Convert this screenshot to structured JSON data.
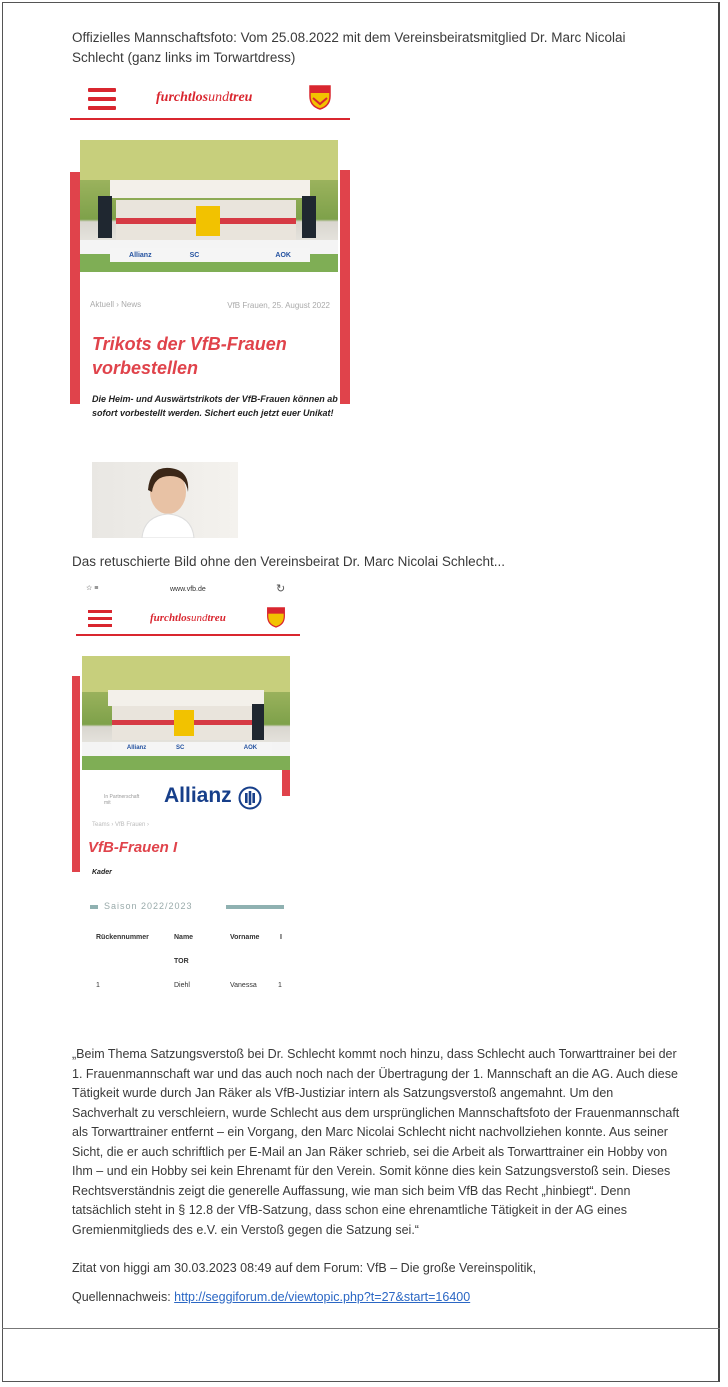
{
  "caption_top": "Offizielles Mannschaftsfoto: Vom 25.08.2022 mit dem Vereinsbeiratsmitglied Dr. Marc Nicolai Schlecht (ganz links im Torwartdress)",
  "brand": {
    "bold": "furchtlos",
    "thin": "und",
    "tail": "treu"
  },
  "sponsors": [
    "Allianz",
    "SC",
    "",
    "AOK"
  ],
  "card1": {
    "meta_left": "Aktuell › News",
    "meta_right": "VfB Frauen, 25. August 2022",
    "title": "Trikots der VfB-Frauen vorbestellen",
    "body": "Die Heim- und Auswärtstrikots der VfB-Frauen können ab sofort vorbestellt werden. Sichert euch jetzt euer Unikat!"
  },
  "caption_mid": "Das retuschierte Bild ohne den Vereinsbeirat Dr. Marc Nicolai Schlecht...",
  "card2": {
    "url": "www.vfb.de",
    "allianz_small": "In Partnerschaft mit",
    "allianz": "Allianz",
    "breadcrumb": "Teams › VfB Frauen ›",
    "title": "VfB-Frauen I",
    "subtitle": "Kader",
    "season": "Saison 2022/2023",
    "table_headers": [
      "Rückennummer",
      "Name",
      "Vorname",
      "I"
    ],
    "section": "TOR",
    "row": [
      "1",
      "Diehl",
      "Vanessa",
      "1"
    ]
  },
  "quote": "„Beim Thema Satzungsverstoß bei Dr. Schlecht kommt noch hinzu, dass Schlecht auch Torwarttrainer bei der 1. Frauenmannschaft war und das auch noch nach der Übertragung der 1. Mannschaft an die AG. Auch diese Tätigkeit wurde durch Jan Räker als VfB-Justiziar intern als Satzungsverstoß angemahnt. Um den Sachverhalt zu verschleiern, wurde Schlecht aus dem ursprünglichen Mannschaftsfoto der Frauenmannschaft als Torwarttrainer entfernt – ein Vorgang, den Marc Nicolai Schlecht nicht nachvollziehen konnte. Aus seiner Sicht, die er auch schriftlich per E-Mail an Jan Räker schrieb, sei die Arbeit als Torwarttrainer ein Hobby von Ihm – und ein Hobby sei kein Ehrenamt für den Verein. Somit könne dies kein Satzungsverstoß sein. Dieses Rechtsverständnis zeigt die generelle Auffassung, wie man sich beim VfB das Recht „hinbiegt“. Denn tatsächlich steht in § 12.8 der VfB-Satzung, dass schon eine ehrenamtliche Tätigkeit in der AG eines Gremienmitglieds des e.V. ein Verstoß gegen die Satzung sei.“",
  "citation": "Zitat von higgi am 30.03.2023 08:49 auf dem Forum: VfB – Die große Vereinspolitik,",
  "source_label": "Quellennachweis:",
  "source_url": "http://seggiforum.de/viewtopic.php?t=27&start=16400"
}
